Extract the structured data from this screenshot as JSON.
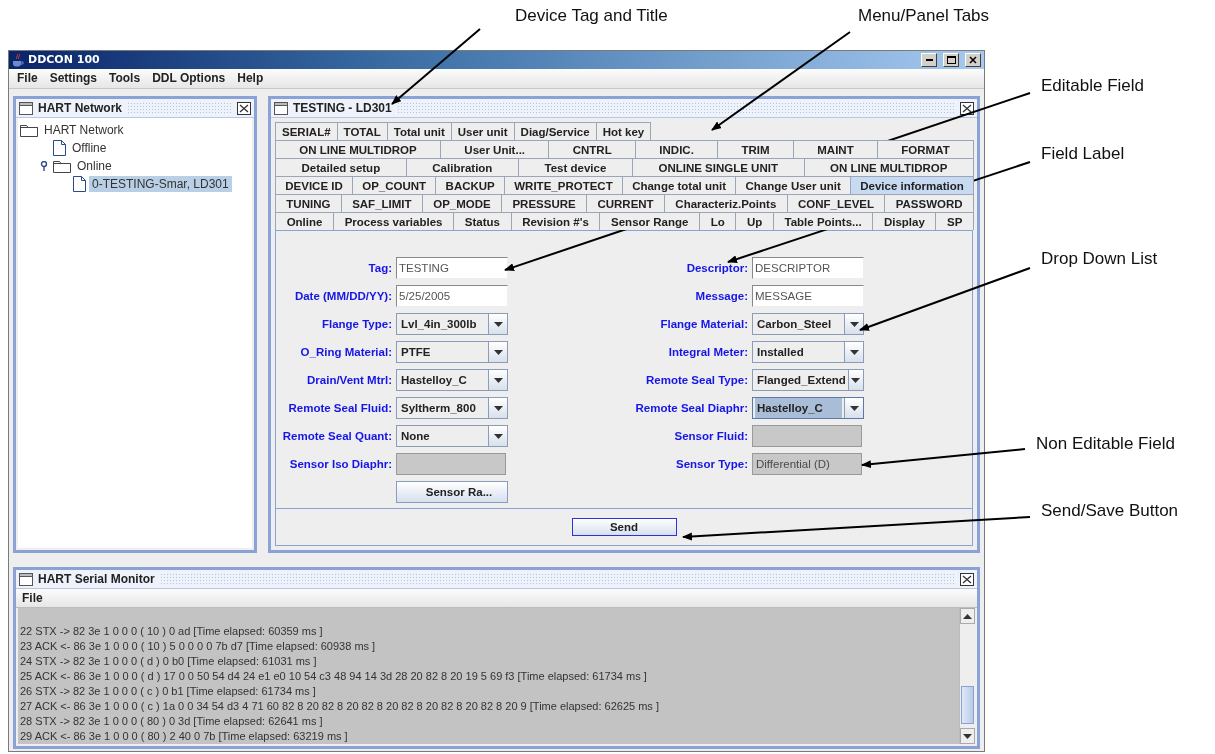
{
  "window": {
    "title": "DDCON 100",
    "menu": [
      "File",
      "Settings",
      "Tools",
      "DDL Options",
      "Help"
    ]
  },
  "network_panel": {
    "title": "HART Network",
    "tree": [
      {
        "label": "HART Network",
        "kind": "folder",
        "selected": false,
        "children": [
          {
            "label": "Offline",
            "kind": "file",
            "selected": false
          },
          {
            "label": "Online",
            "kind": "folder",
            "expanded": true,
            "selected": false,
            "children": [
              {
                "label": "0-TESTING-Smar, LD301",
                "kind": "file",
                "selected": true
              }
            ]
          }
        ]
      }
    ]
  },
  "device_panel": {
    "title": "TESTING - LD301",
    "tab_rows": [
      [
        {
          "label": "SERIAL#",
          "selected": false
        },
        {
          "label": "TOTAL",
          "selected": false
        },
        {
          "label": "Total unit",
          "selected": false
        },
        {
          "label": "User unit",
          "selected": false
        },
        {
          "label": "Diag/Service",
          "selected": false
        },
        {
          "label": "Hot key",
          "selected": false
        }
      ],
      [
        {
          "label": "ON LINE MULTIDROP",
          "selected": false
        },
        {
          "label": "User Unit...",
          "selected": false
        },
        {
          "label": "CNTRL",
          "selected": false
        },
        {
          "label": "INDIC.",
          "selected": false
        },
        {
          "label": "TRIM",
          "selected": false
        },
        {
          "label": "MAINT",
          "selected": false
        },
        {
          "label": "FORMAT",
          "selected": false
        }
      ],
      [
        {
          "label": "Detailed setup",
          "selected": false
        },
        {
          "label": "Calibration",
          "selected": false
        },
        {
          "label": "Test device",
          "selected": false
        },
        {
          "label": "ONLINE SINGLE UNIT",
          "selected": false
        },
        {
          "label": "ON LINE MULTIDROP",
          "selected": false
        }
      ],
      [
        {
          "label": "DEVICE ID",
          "selected": false
        },
        {
          "label": "OP_COUNT",
          "selected": false
        },
        {
          "label": "BACKUP",
          "selected": false
        },
        {
          "label": "WRITE_PROTECT",
          "selected": false
        },
        {
          "label": "Change total unit",
          "selected": false
        },
        {
          "label": "Change User unit",
          "selected": false
        },
        {
          "label": "Device information",
          "selected": true
        }
      ],
      [
        {
          "label": "TUNING",
          "selected": false
        },
        {
          "label": "SAF_LIMIT",
          "selected": false
        },
        {
          "label": "OP_MODE",
          "selected": false
        },
        {
          "label": "PRESSURE",
          "selected": false
        },
        {
          "label": "CURRENT",
          "selected": false
        },
        {
          "label": "Characteriz.Points",
          "selected": false
        },
        {
          "label": "CONF_LEVEL",
          "selected": false
        },
        {
          "label": "PASSWORD",
          "selected": false
        }
      ],
      [
        {
          "label": "Online",
          "selected": false
        },
        {
          "label": "Process variables",
          "selected": false
        },
        {
          "label": "Status",
          "selected": false
        },
        {
          "label": "Revision #'s",
          "selected": false
        },
        {
          "label": "Sensor Range",
          "selected": false
        },
        {
          "label": "Lo",
          "selected": false
        },
        {
          "label": "Up",
          "selected": false
        },
        {
          "label": "Table Points...",
          "selected": false
        },
        {
          "label": "Display",
          "selected": false
        },
        {
          "label": "SP",
          "selected": false
        }
      ]
    ],
    "left_fields": [
      {
        "label": "Tag:",
        "kind": "text",
        "value": "TESTING"
      },
      {
        "label": "Date (MM/DD/YY):",
        "kind": "text",
        "value": "5/25/2005"
      },
      {
        "label": "Flange Type:",
        "kind": "dropdown",
        "value": "Lvl_4in_300lb",
        "focused": false
      },
      {
        "label": "O_Ring Material:",
        "kind": "dropdown",
        "value": "PTFE",
        "focused": false
      },
      {
        "label": "Drain/Vent Mtrl:",
        "kind": "dropdown",
        "value": "Hastelloy_C",
        "focused": false
      },
      {
        "label": "Remote Seal Fluid:",
        "kind": "dropdown",
        "value": "Syltherm_800",
        "focused": false
      },
      {
        "label": "Remote Seal Quant:",
        "kind": "dropdown",
        "value": "None",
        "focused": false
      },
      {
        "label": "Sensor Iso Diaphr:",
        "kind": "readonly"
      }
    ],
    "range_button": "Sensor Ra...",
    "right_fields": [
      {
        "label": "Descriptor:",
        "kind": "text",
        "value": "DESCRIPTOR"
      },
      {
        "label": "Message:",
        "kind": "text",
        "value": "MESSAGE"
      },
      {
        "label": "Flange Material:",
        "kind": "dropdown",
        "value": "Carbon_Steel",
        "focused": false
      },
      {
        "label": "Integral Meter:",
        "kind": "dropdown",
        "value": "Installed",
        "focused": false
      },
      {
        "label": "Remote Seal Type:",
        "kind": "dropdown",
        "value": "Flanged_Extend",
        "focused": false
      },
      {
        "label": "Remote Seal Diaphr:",
        "kind": "dropdown",
        "value": "Hastelloy_C",
        "focused": true
      },
      {
        "label": "Sensor Fluid:",
        "kind": "readonly"
      },
      {
        "label": "Sensor Type:",
        "kind": "readonly",
        "value": "Differential (D)"
      }
    ],
    "send_button": "Send"
  },
  "serial_monitor": {
    "title": "HART Serial Monitor",
    "menu": [
      "File"
    ],
    "lines": [
      "22 STX -> 82 3e 1 0 0 0  ( 10 )  0 ad  [Time elapsed: 60359 ms ]",
      "23 ACK <- 86 3e 1 0 0 0  ( 10 )  5 0 0 0 0 7b d7  [Time elapsed: 60938 ms ]",
      "24 STX -> 82 3e 1 0 0 0  ( d )  0 b0  [Time elapsed: 61031 ms ]",
      "25 ACK <- 86 3e 1 0 0 0  ( d )  17 0 0 50 54 d4 24 e1 e0 10 54 c3 48 94 14 3d 28 20 82 8 20 19 5 69 f3  [Time elapsed: 61734 ms ]",
      "26 STX -> 82 3e 1 0 0 0  ( c )  0 b1  [Time elapsed: 61734 ms ]",
      "27 ACK <- 86 3e 1 0 0 0  ( c )  1a 0 0 34 54 d3 4 71 60 82 8 20 82 8 20 82 8 20 82 8 20 82 8 20 82 8 20 9  [Time elapsed: 62625 ms ]",
      "28 STX -> 82 3e 1 0 0 0  ( 80 )  0 3d  [Time elapsed: 62641 ms ]",
      "29 ACK <- 86 3e 1 0 0 0  ( 80 )  2 40 0 7b  [Time elapsed: 63219 ms ]"
    ]
  },
  "annotations": [
    "Device Tag and Title",
    "Menu/Panel Tabs",
    "Editable Field",
    "Field Label",
    "Drop Down List",
    "Non Editable Field",
    "Send/Save Button"
  ]
}
